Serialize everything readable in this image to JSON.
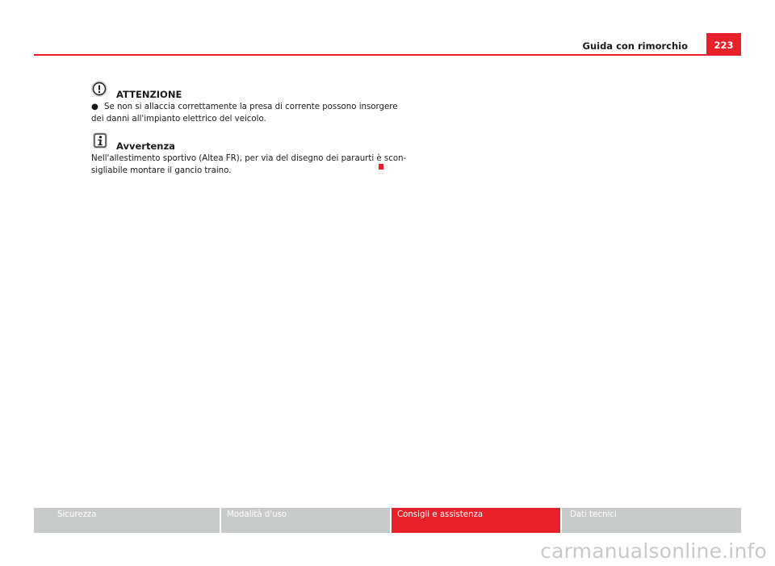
{
  "header": {
    "title": "Guida con rimorchio",
    "page_number": "223"
  },
  "warning": {
    "icon": "exclamation-circle-icon",
    "heading": "ATTENZIONE",
    "bullet": "●",
    "line1": "Se non si allaccia correttamente la presa di corrente possono insorgere",
    "line2": "dei danni all'impianto elettrico del veicolo."
  },
  "note": {
    "icon": "info-icon",
    "heading": "Avvertenza",
    "line1": "Nell'allestimento sportivo (Altea FR), per via del disegno dei paraurti è scon-",
    "line2": "sigliabile montare il gancio traino."
  },
  "footer": {
    "tabs": [
      {
        "label": "Sicurezza"
      },
      {
        "label": "Modalità d'uso"
      },
      {
        "label": "Consigli e assistenza"
      },
      {
        "label": "Dati tecnici"
      }
    ],
    "active_index": 2
  },
  "watermark": "carmanualsonline.info",
  "colors": {
    "accent": "#e8202a",
    "tab_inactive": "#c7cbc9"
  }
}
